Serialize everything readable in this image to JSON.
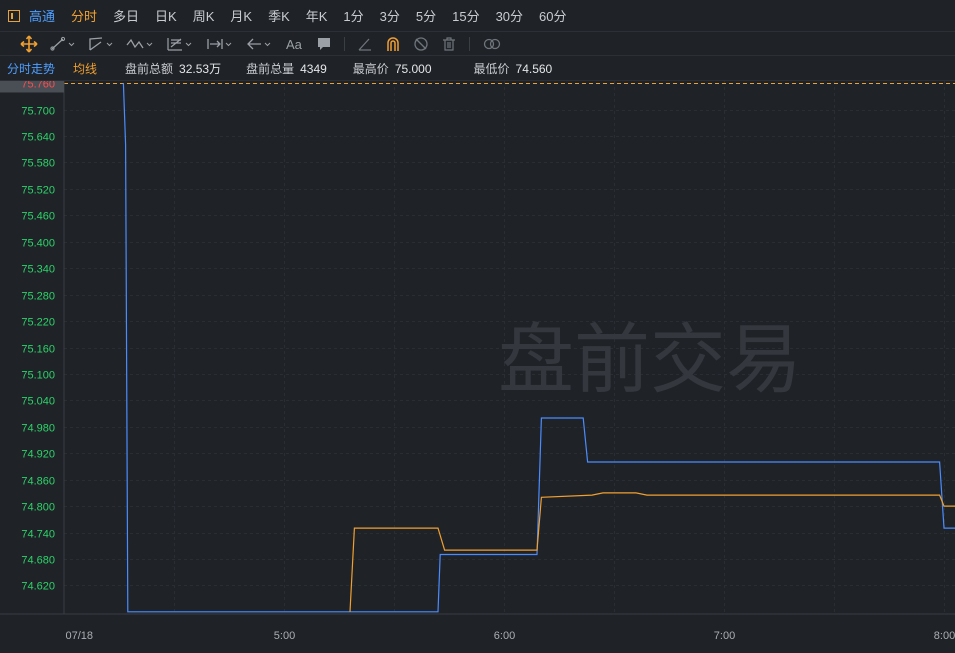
{
  "toolbar": {
    "symbol": "高通",
    "periods": [
      "分时",
      "多日",
      "日K",
      "周K",
      "月K",
      "季K",
      "年K",
      "1分",
      "3分",
      "5分",
      "15分",
      "30分",
      "60分"
    ],
    "active_period": "分时"
  },
  "drawing_tools": [
    "move-icon",
    "line-icon",
    "channel-icon",
    "wave-icon",
    "fib-icon",
    "range-icon",
    "arrow-icon",
    "text-icon",
    "comment-icon",
    "ruler-icon",
    "magnet-icon",
    "hide-icon",
    "trash-icon",
    "link-icon"
  ],
  "info": {
    "mode_label": "分时走势",
    "avg_label": "均线",
    "amount_label": "盘前总额",
    "amount_value": "32.53万",
    "volume_label": "盘前总量",
    "volume_value": "4349",
    "high_label": "最高价",
    "high_value": "75.000",
    "low_label": "最低价",
    "low_value": "74.560"
  },
  "watermark": "盘前交易",
  "colors": {
    "price": "#4a8cff",
    "avg": "#f0a030",
    "up": "#2bd46b",
    "prev": "#ff4d4d"
  },
  "chart_data": {
    "type": "line",
    "x_ticks": [
      {
        "t": 4.0,
        "label": "07/18"
      },
      {
        "t": 5.0,
        "label": "5:00"
      },
      {
        "t": 6.0,
        "label": "6:00"
      },
      {
        "t": 7.0,
        "label": "7:00"
      },
      {
        "t": 8.0,
        "label": "8:00"
      }
    ],
    "xlim": [
      4.0,
      8.05
    ],
    "ylim": [
      74.555,
      75.765
    ],
    "y_ticks": [
      "75.700",
      "75.640",
      "75.580",
      "75.520",
      "75.460",
      "75.400",
      "75.340",
      "75.280",
      "75.220",
      "75.160",
      "75.100",
      "75.040",
      "74.980",
      "74.920",
      "74.860",
      "74.800",
      "74.740",
      "74.680",
      "74.620"
    ],
    "prev_close": "75.760",
    "series": [
      {
        "name": "",
        "color": "#4a8cff",
        "x": [
          4.27,
          4.28,
          4.29,
          5.7,
          5.71,
          6.15,
          6.17,
          6.36,
          6.38,
          7.98,
          8.0,
          8.05
        ],
        "y": [
          75.76,
          75.62,
          74.56,
          74.56,
          74.69,
          74.69,
          75.0,
          75.0,
          74.9,
          74.9,
          74.75,
          74.75
        ]
      },
      {
        "name": "",
        "color": "#f0a030",
        "x": [
          5.3,
          5.32,
          5.7,
          5.73,
          6.15,
          6.17,
          6.4,
          6.45,
          6.6,
          6.65,
          7.98,
          8.0,
          8.05
        ],
        "y": [
          74.56,
          74.75,
          74.75,
          74.7,
          74.7,
          74.82,
          74.825,
          74.83,
          74.83,
          74.825,
          74.825,
          74.8,
          74.8
        ]
      }
    ]
  }
}
